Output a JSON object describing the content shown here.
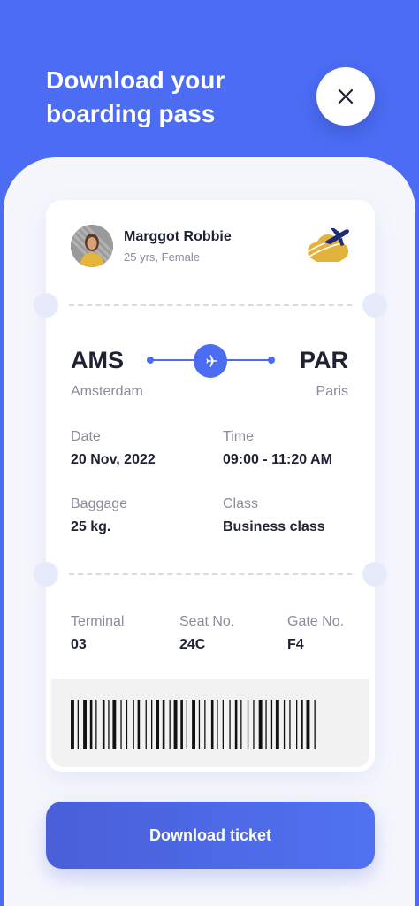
{
  "header": {
    "title": "Download your\nboarding pass",
    "close_icon": "close-icon"
  },
  "passenger": {
    "name": "Marggot Robbie",
    "meta": "25 yrs, Female"
  },
  "flight": {
    "origin": {
      "code": "AMS",
      "city": "Amsterdam"
    },
    "destination": {
      "code": "PAR",
      "city": "Paris"
    },
    "plane_icon": "airplane-icon"
  },
  "details": {
    "date_label": "Date",
    "date_value": "20 Nov, 2022",
    "time_label": "Time",
    "time_value": "09:00 - 11:20 AM",
    "baggage_label": "Baggage",
    "baggage_value": "25 kg.",
    "class_label": "Class",
    "class_value": "Business class"
  },
  "gate_info": {
    "terminal_label": "Terminal",
    "terminal_value": "03",
    "seat_label": "Seat No.",
    "seat_value": "24C",
    "gate_label": "Gate No.",
    "gate_value": "F4"
  },
  "actions": {
    "download_label": "Download ticket"
  },
  "colors": {
    "accent": "#4b6cf3",
    "logo_gold": "#e3b23c",
    "logo_navy": "#1e2a78"
  }
}
